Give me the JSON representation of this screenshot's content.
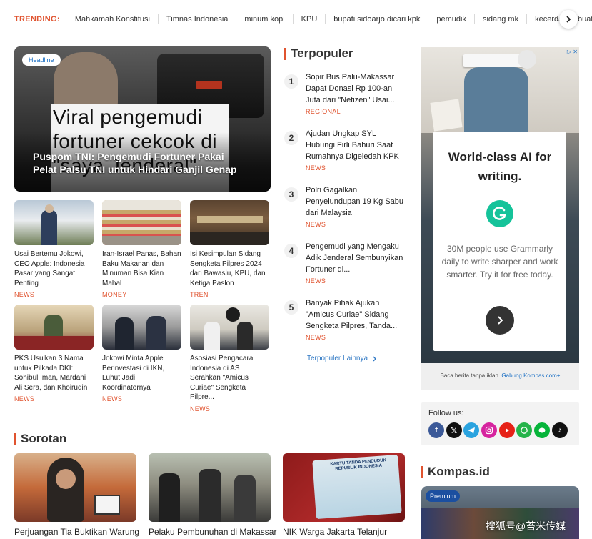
{
  "trending": {
    "label": "TRENDING:",
    "items": [
      "Mahkamah Konstitusi",
      "Timnas Indonesia",
      "minum kopi",
      "KPU",
      "bupati sidoarjo dicari kpk",
      "pemudik",
      "sidang mk",
      "kecerdasan buatan"
    ]
  },
  "headline": {
    "badge": "Headline",
    "image_caption": "Viral pengemudi fortuner cekcok di \"saya Jenderal\"",
    "title": "Puspom TNI: Pengemudi Fortuner Pakai Pelat Palsu TNI untuk Hindari Ganjil Genap"
  },
  "grid": [
    {
      "title": "Usai Bertemu Jokowi, CEO Apple: Indonesia Pasar yang Sangat Penting",
      "category": "NEWS"
    },
    {
      "title": "Iran-Israel Panas, Bahan Baku Makanan dan Minuman Bisa Kian Mahal",
      "category": "MONEY"
    },
    {
      "title": "Isi Kesimpulan Sidang Sengketa Pilpres 2024 dari Bawaslu, KPU, dan Ketiga Paslon",
      "category": "TREN"
    },
    {
      "title": "PKS Usulkan 3 Nama untuk Pilkada DKI: Sohibul Iman, Mardani Ali Sera, dan Khoirudin",
      "category": "NEWS"
    },
    {
      "title": "Jokowi Minta Apple Berinvestasi di IKN, Luhut Jadi Koordinatornya",
      "category": "NEWS"
    },
    {
      "title": "Asosiasi Pengacara Indonesia di AS Serahkan \"Amicus Curiae\" Sengketa Pilpre...",
      "category": "NEWS"
    }
  ],
  "terpopuler": {
    "title": "Terpopuler",
    "items": [
      {
        "num": "1",
        "title": "Sopir Bus Palu-Makassar Dapat Donasi Rp 100-an Juta dari \"Netizen\" Usai...",
        "category": "REGIONAL"
      },
      {
        "num": "2",
        "title": "Ajudan Ungkap SYL Hubungi Firli Bahuri Saat Rumahnya Digeledah KPK",
        "category": "NEWS"
      },
      {
        "num": "3",
        "title": "Polri Gagalkan Penyelundupan 19 Kg Sabu dari Malaysia",
        "category": "NEWS"
      },
      {
        "num": "4",
        "title": "Pengemudi yang Mengaku Adik Jenderal Sembunyikan Fortuner di...",
        "category": "NEWS"
      },
      {
        "num": "5",
        "title": "Banyak Pihak Ajukan \"Amicus Curiae\" Sidang Sengketa Pilpres, Tanda...",
        "category": "NEWS"
      }
    ],
    "more": "Terpopuler Lainnya"
  },
  "ad": {
    "headline": "World-class AI for writing.",
    "body": "30M people use Grammarly daily to write sharper and work smarter. Try it for free today.",
    "footer_text": "Baca berita tanpa iklan.",
    "footer_link": "Gabung Kompas.com+"
  },
  "follow": {
    "label": "Follow us:",
    "icons": [
      "facebook-icon",
      "x-icon",
      "telegram-icon",
      "instagram-icon",
      "youtube-icon",
      "whatsapp-icon",
      "line-icon",
      "tiktok-icon"
    ]
  },
  "sorotan": {
    "title": "Sorotan",
    "items": [
      {
        "title": "Perjuangan Tia Buktikan Warung"
      },
      {
        "title": "Pelaku Pembunuhan di Makassar"
      },
      {
        "title": "NIK Warga Jakarta Telanjur"
      }
    ],
    "map_caption": "KARTU TANDA PENDUDUK REPUBLIK INDONESIA"
  },
  "kompas_id": {
    "title": "Kompas.id",
    "badge": "Premium"
  },
  "watermark": "搜狐号@苔米传媒",
  "colors": {
    "accent": "#e0532f",
    "link": "#2f78c4"
  }
}
